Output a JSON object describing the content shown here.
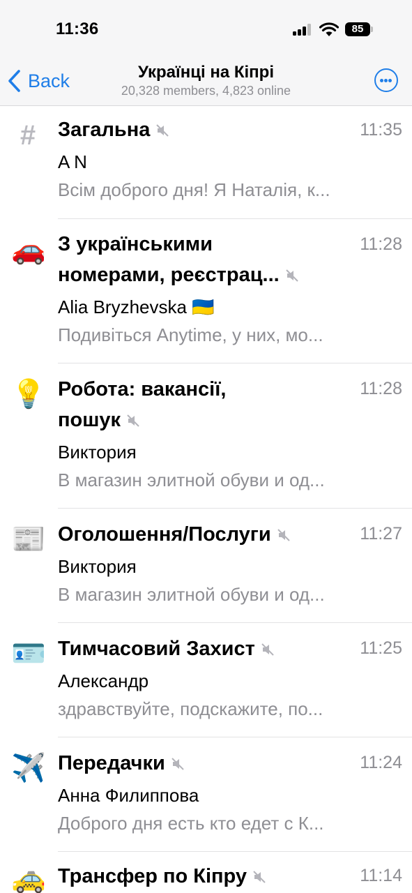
{
  "status_bar": {
    "time": "11:36",
    "battery": "85"
  },
  "header": {
    "back_label": "Back",
    "title": "Українці на Кіпрі",
    "subtitle": "20,328 members, 4,823 online"
  },
  "colors": {
    "accent": "#1f7ee8",
    "secondary_text": "#8e8e93",
    "separator": "#e2e2e4"
  },
  "topics": [
    {
      "icon": "#",
      "icon_name": "hash-icon",
      "title": "Загальна",
      "time": "11:35",
      "sender": "A N",
      "preview": "Всім доброго дня! Я Наталія, к...",
      "muted": true
    },
    {
      "icon": "🚗",
      "icon_name": "car-icon",
      "title_line1": "З українськими",
      "title_line2": "номерами, реєстрац...",
      "time": "11:28",
      "sender": "Alia Bryzhevska 🇺🇦",
      "preview": "Подивіться Anytime, у них, мо...",
      "muted": true
    },
    {
      "icon": "💡",
      "icon_name": "lightbulb-icon",
      "title_line1": "Робота: вакансії,",
      "title_line2": "пошук",
      "time": "11:28",
      "sender": "Виктория",
      "preview": "В магазин элитной обуви и од...",
      "muted": true
    },
    {
      "icon": "📰",
      "icon_name": "newspaper-icon",
      "title": "Оголошення/Послуги",
      "time": "11:27",
      "sender": "Виктория",
      "preview": "В магазин элитной обуви и од...",
      "muted": true
    },
    {
      "icon": "🪪",
      "icon_name": "id-card-icon",
      "title": "Тимчасовий Захист",
      "time": "11:25",
      "sender": "Александр",
      "preview": "здравствуйте, подскажите, по...",
      "muted": true
    },
    {
      "icon": "✈️",
      "icon_name": "airplane-icon",
      "title": "Передачки",
      "time": "11:24",
      "sender": "Анна Филиппова",
      "preview": "Доброго дня есть кто едет с К...",
      "muted": true
    },
    {
      "icon": "🚕",
      "icon_name": "taxi-icon",
      "title": "Трансфер по Кіпру",
      "time": "11:14",
      "muted": true
    }
  ]
}
